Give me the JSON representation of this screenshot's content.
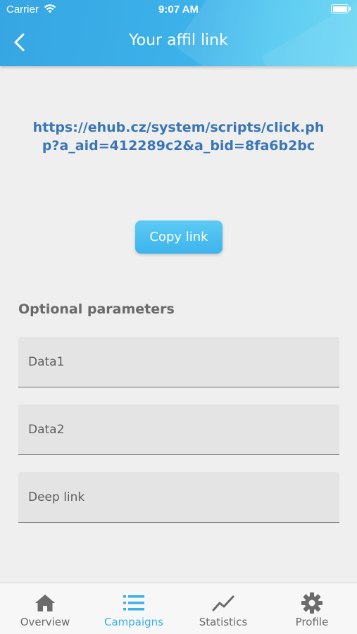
{
  "status_bar": {
    "carrier": "Carrier",
    "time": "9:07 AM"
  },
  "header": {
    "title": "Your affil link",
    "back_icon": "chevron-left-icon",
    "gradient_colors": [
      "#36a6e2",
      "#5fd3f3"
    ]
  },
  "main": {
    "affil_link": "https://ehub.cz/system/scripts/click.php?a_aid=412289c2&a_bid=8fa6b2bc",
    "link_color": "#3a76b5",
    "copy_button_label": "Copy link",
    "optional_heading": "Optional parameters",
    "fields": [
      {
        "placeholder": "Data1",
        "value": ""
      },
      {
        "placeholder": "Data2",
        "value": ""
      },
      {
        "placeholder": "Deep link",
        "value": ""
      }
    ]
  },
  "tab_bar": {
    "accent_color": "#3bb0ea",
    "tabs": [
      {
        "label": "Overview",
        "icon": "home-icon",
        "active": false
      },
      {
        "label": "Campaigns",
        "icon": "list-icon",
        "active": true
      },
      {
        "label": "Statistics",
        "icon": "chart-line-icon",
        "active": false
      },
      {
        "label": "Profile",
        "icon": "gear-icon",
        "active": false
      }
    ]
  }
}
